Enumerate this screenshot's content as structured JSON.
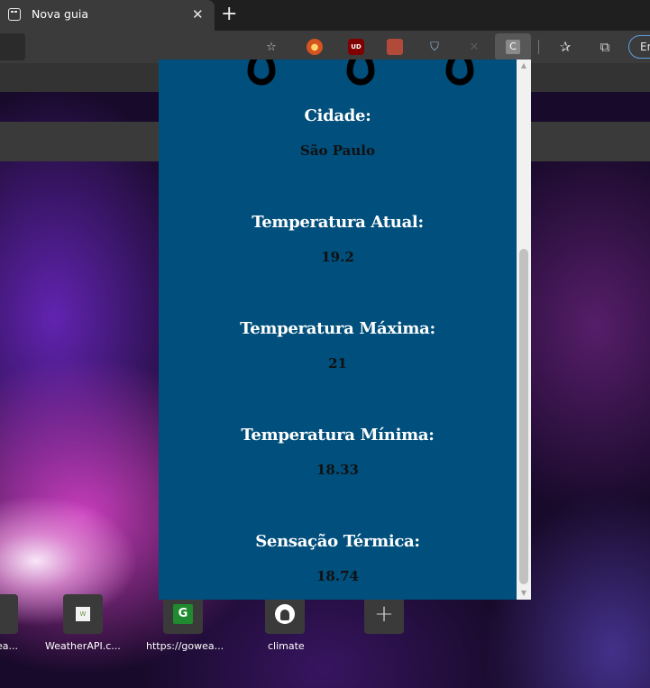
{
  "browser": {
    "tab_title": "Nova guia",
    "tab_close": "✕",
    "new_tab": "+",
    "profile_label": "En",
    "extension_letter": "C"
  },
  "new_tab_page": {
    "tiles": [
      {
        "label": "ea..."
      },
      {
        "label": "WeatherAPI.c..."
      },
      {
        "label": "https://gowea..."
      },
      {
        "label": "climate"
      }
    ],
    "add_tile": "+",
    "g_tile_letter": "G",
    "w_tile_letter": "W"
  },
  "popup": {
    "fields": [
      {
        "label": "Cidade:",
        "value": "São Paulo"
      },
      {
        "label": "Temperatura Atual:",
        "value": "19.2"
      },
      {
        "label": "Temperatura Máxima:",
        "value": "21"
      },
      {
        "label": "Temperatura Mínima:",
        "value": "18.33"
      },
      {
        "label": "Sensação Térmica:",
        "value": "18.74"
      }
    ],
    "scrollbar": {
      "up": "▲",
      "down": "▼"
    }
  }
}
